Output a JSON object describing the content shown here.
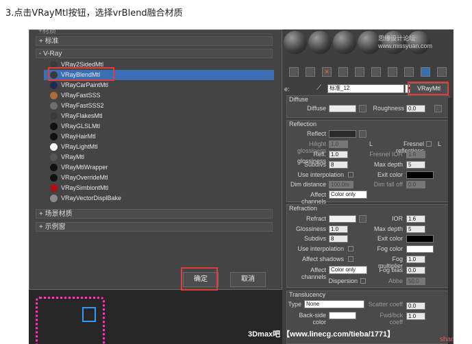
{
  "caption": "3.点击VRayMtl按钮，选择vrBlend融合材质",
  "browser": {
    "top_label": "+材质",
    "group_standard": "+ 标准",
    "group_vray": "- V-Ray",
    "group_scene": "+ 场景材质",
    "group_sample": "+ 示例窗",
    "materials": [
      {
        "name": "VRay2SidedMtl",
        "swatch": "#3a3a3a"
      },
      {
        "name": "VRayBlendMtl",
        "swatch": "#3a3a3a",
        "selected": true
      },
      {
        "name": "VRayCarPaintMtl",
        "swatch": "#1e2b55"
      },
      {
        "name": "VRayFastSSS",
        "swatch": "#b36a3a"
      },
      {
        "name": "VRayFastSSS2",
        "swatch": "#6e6e6e"
      },
      {
        "name": "VRayFlakesMtl",
        "swatch": "#3a3a3a"
      },
      {
        "name": "VRayGLSLMtl",
        "swatch": "#111111"
      },
      {
        "name": "VRayHairMtl",
        "swatch": "#111111"
      },
      {
        "name": "VRayLightMtl",
        "swatch": "#ffffff"
      },
      {
        "name": "VRayMtl",
        "swatch": "#555555"
      },
      {
        "name": "VRayMtlWrapper",
        "swatch": "#111111"
      },
      {
        "name": "VRayOverrideMtl",
        "swatch": "#111111"
      },
      {
        "name": "VRaySimbiontMtl",
        "swatch": "#b01010"
      },
      {
        "name": "VRayVectorDisplBake",
        "swatch": "#8a8a8a"
      }
    ],
    "ok_label": "确定",
    "cancel_label": "取消"
  },
  "editor": {
    "watermark": "思缘设计论坛 www.missyuan.com",
    "name_label": "e:",
    "material_name": "标准_12",
    "type_button": "VRayMtl",
    "diffuse": {
      "header": "Diffuse",
      "diffuse_label": "Diffuse",
      "roughness_label": "Roughness",
      "roughness_value": "0.0"
    },
    "reflection": {
      "header": "Reflection",
      "reflect_label": "Reflect",
      "hilight_label": "Hilight glossiness",
      "hilight_value": "1.0",
      "l_button": "L",
      "fresnel_label": "Fresnel reflections",
      "refl_gloss_label": "Refl. glossiness",
      "refl_gloss_value": "1.0",
      "fresnel_ior_label": "Fresnel IOR",
      "fresnel_ior_value": "1.6",
      "subdivs_label": "Subdivs",
      "subdivs_value": "8",
      "max_depth_label": "Max depth",
      "max_depth_value": "5",
      "interp_label": "Use interpolation",
      "exit_color_label": "Exit color",
      "dim_dist_label": "Dim distance",
      "dim_dist_value": "100.0m",
      "dim_falloff_label": "Dim fall off",
      "dim_falloff_value": "0.0",
      "affect_label": "Affect channels",
      "affect_value": "Color only"
    },
    "refraction": {
      "header": "Refraction",
      "refract_label": "Refract",
      "ior_label": "IOR",
      "ior_value": "1.6",
      "gloss_label": "Glossiness",
      "gloss_value": "1.0",
      "max_depth_label": "Max depth",
      "max_depth_value": "5",
      "subdivs_label": "Subdivs",
      "subdivs_value": "8",
      "exit_color_label": "Exit color",
      "interp_label": "Use interpolation",
      "fog_color_label": "Fog color",
      "affect_shadows_label": "Affect shadows",
      "fog_mult_label": "Fog multiplier",
      "fog_mult_value": "1.0",
      "affect_label": "Affect channels",
      "affect_value": "Color only",
      "fog_bias_label": "Fog bias",
      "fog_bias_value": "0.0",
      "dispersion_label": "Dispersion",
      "abbe_label": "Abbe",
      "abbe_value": "50.0"
    },
    "translucency": {
      "header": "Translucency",
      "type_label": "Type",
      "type_value": "None",
      "scatter_label": "Scatter coeff",
      "scatter_value": "0.0",
      "backside_label": "Back-side color",
      "fwd_label": "Fwd/bck coeff",
      "fwd_value": "1.0"
    }
  },
  "footer": "3Dmax吧 【www.linecg.com/tieba/1771】",
  "footer_tag": "shancun"
}
